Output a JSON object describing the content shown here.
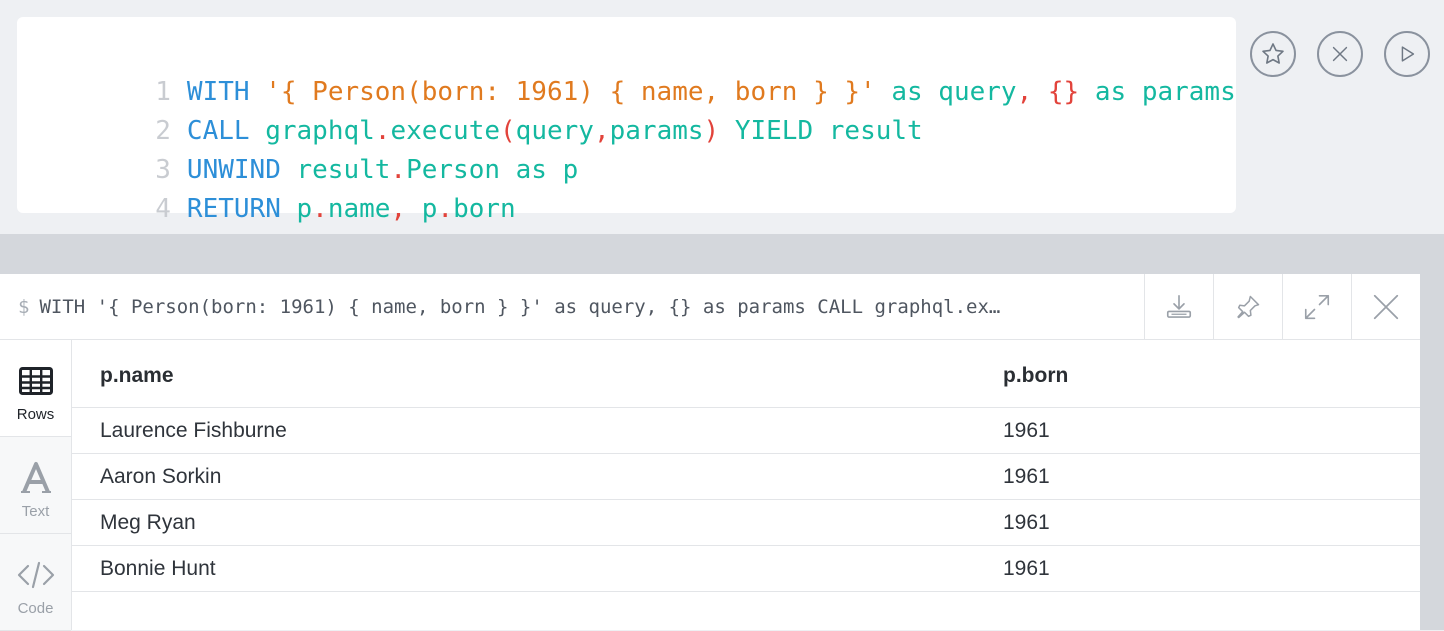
{
  "editor": {
    "lines": [
      {
        "num": "1",
        "tokens": [
          {
            "t": "WITH",
            "c": "kw"
          },
          {
            "t": " ",
            "c": "id"
          },
          {
            "t": "'{ Person(born: 1961) { name, born } }'",
            "c": "str"
          },
          {
            "t": " as query",
            "c": "id"
          },
          {
            "t": ",",
            "c": "pn"
          },
          {
            "t": " ",
            "c": "id"
          },
          {
            "t": "{}",
            "c": "pn"
          },
          {
            "t": " as params",
            "c": "id"
          }
        ]
      },
      {
        "num": "2",
        "tokens": [
          {
            "t": "CALL",
            "c": "kw"
          },
          {
            "t": " graphql",
            "c": "id"
          },
          {
            "t": ".",
            "c": "pn"
          },
          {
            "t": "execute",
            "c": "id"
          },
          {
            "t": "(",
            "c": "pn"
          },
          {
            "t": "query",
            "c": "id"
          },
          {
            "t": ",",
            "c": "pn"
          },
          {
            "t": "params",
            "c": "id"
          },
          {
            "t": ")",
            "c": "pn"
          },
          {
            "t": " YIELD result",
            "c": "id"
          }
        ]
      },
      {
        "num": "3",
        "tokens": [
          {
            "t": "UNWIND",
            "c": "kw"
          },
          {
            "t": " result",
            "c": "id"
          },
          {
            "t": ".",
            "c": "pn"
          },
          {
            "t": "Person as p",
            "c": "id"
          }
        ]
      },
      {
        "num": "4",
        "tokens": [
          {
            "t": "RETURN",
            "c": "kw"
          },
          {
            "t": " p",
            "c": "id"
          },
          {
            "t": ".",
            "c": "pn"
          },
          {
            "t": "name",
            "c": "id"
          },
          {
            "t": ",",
            "c": "pn"
          },
          {
            "t": " p",
            "c": "id"
          },
          {
            "t": ".",
            "c": "pn"
          },
          {
            "t": "born",
            "c": "id"
          }
        ]
      }
    ],
    "actions": [
      "star-icon",
      "close-circle-icon",
      "play-icon"
    ]
  },
  "frame": {
    "prompt": "$",
    "query": "WITH '{ Person(born: 1961) { name, born } }' as query, {} as params CALL graphql.ex…",
    "header_actions": [
      "download-icon",
      "pin-icon",
      "expand-icon",
      "close-icon"
    ],
    "sidebar": [
      {
        "label": "Rows",
        "icon": "table-icon",
        "active": true
      },
      {
        "label": "Text",
        "icon": "text-icon",
        "active": false
      },
      {
        "label": "Code",
        "icon": "code-icon",
        "active": false
      }
    ],
    "table": {
      "columns": [
        "p.name",
        "p.born"
      ],
      "rows": [
        [
          "Laurence Fishburne",
          "1961"
        ],
        [
          "Aaron Sorkin",
          "1961"
        ],
        [
          "Meg Ryan",
          "1961"
        ],
        [
          "Bonnie Hunt",
          "1961"
        ]
      ]
    }
  },
  "colors": {
    "keyword": "#2d8fd8",
    "string": "#e07a1f",
    "identifier": "#14b8a0",
    "punctuation": "#e2433b",
    "line_number": "#c9ccd1"
  }
}
